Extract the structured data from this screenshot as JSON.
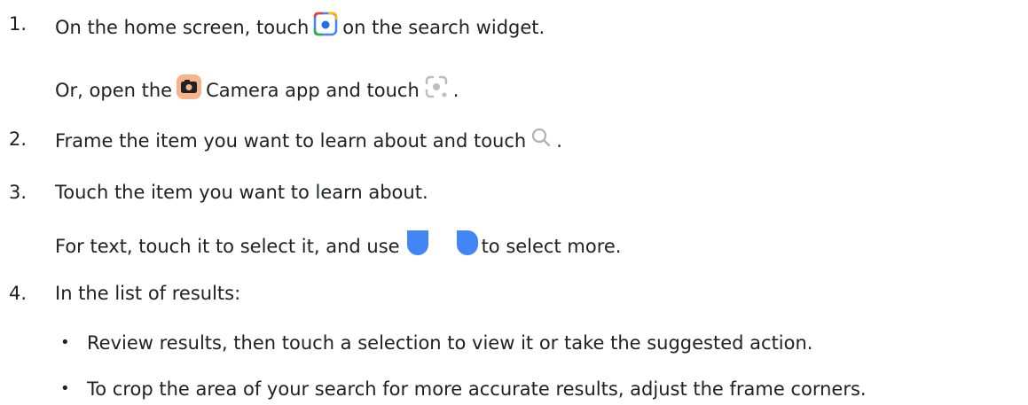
{
  "steps": [
    {
      "number": "1.",
      "text_before": "On the home screen, touch",
      "icon": "google-lens-icon",
      "text_after": "on the search widget.",
      "sub": {
        "text_before": "Or, open the",
        "icon1": "camera-app-icon",
        "text_middle": "Camera app and touch",
        "icon2": "lens-camera-mode-icon",
        "text_after": "."
      }
    },
    {
      "number": "2.",
      "text_before": "Frame the item you want to learn about and touch",
      "icon": "search-icon",
      "text_after": "."
    },
    {
      "number": "3.",
      "text": "Touch the item you want to learn about.",
      "sub": {
        "text_before": "For text, touch it to select it, and use",
        "icon1": "selection-handle-left-icon",
        "icon2": "selection-handle-right-icon",
        "text_after": "to select more."
      }
    },
    {
      "number": "4.",
      "text": "In the list of results:",
      "bullets": [
        "Review results, then touch a selection to view it or take the suggested action.",
        "To crop the area of your search for more accurate results, adjust the frame corners."
      ]
    }
  ],
  "colors": {
    "text": "#202124",
    "lens_blue": "#1a73e8",
    "handle_blue": "#4285f4",
    "camera_bg": "#f6b38c"
  }
}
